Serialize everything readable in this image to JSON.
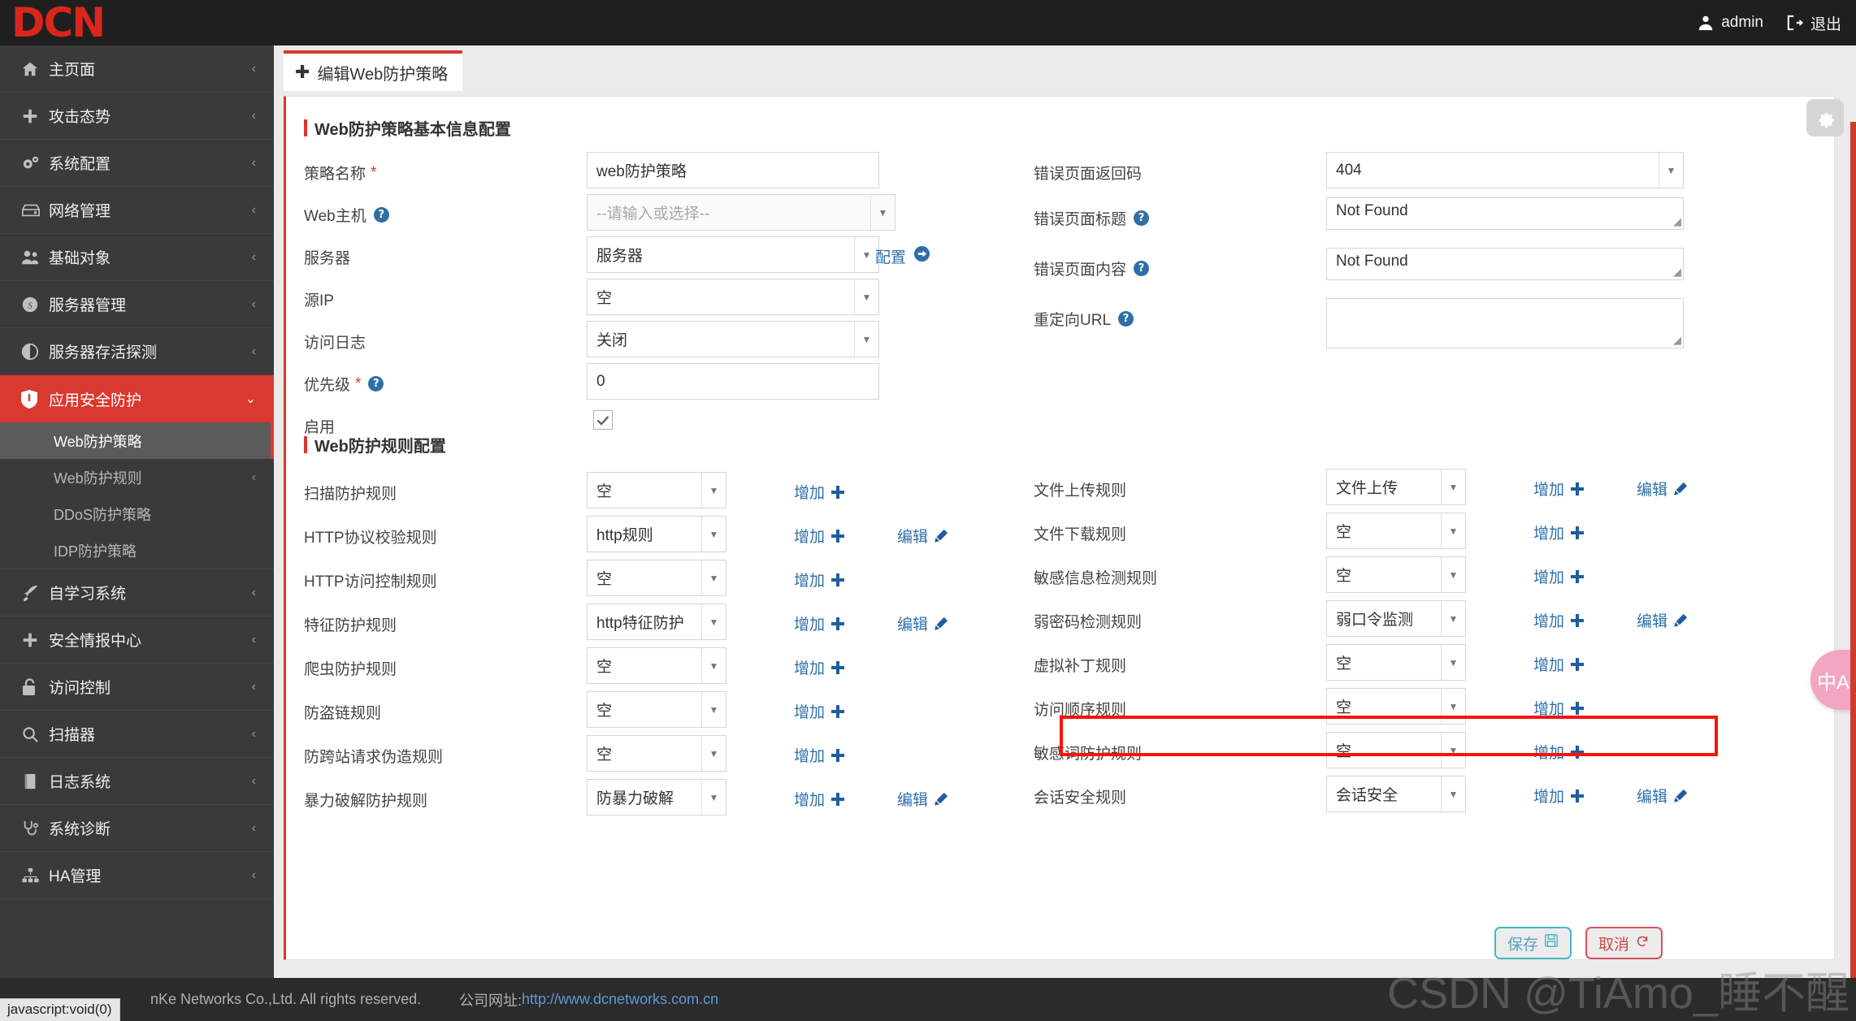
{
  "header": {
    "logo": "DCN",
    "user": "admin",
    "logout": "退出"
  },
  "sidebar": {
    "items": [
      {
        "label": "主页面",
        "icon": "home-icon",
        "arrow": "‹"
      },
      {
        "label": "攻击态势",
        "icon": "plus-icon",
        "arrow": "‹"
      },
      {
        "label": "系统配置",
        "icon": "gears-icon",
        "arrow": "‹"
      },
      {
        "label": "网络管理",
        "icon": "server-icon",
        "arrow": "‹"
      },
      {
        "label": "基础对象",
        "icon": "users-icon",
        "arrow": "‹"
      },
      {
        "label": "服务器管理",
        "icon": "skype-icon",
        "arrow": "‹"
      },
      {
        "label": "服务器存活探测",
        "icon": "contrast-icon",
        "arrow": "‹"
      },
      {
        "label": "应用安全防护",
        "icon": "shield-icon",
        "arrow": "⌄",
        "active": true
      },
      {
        "label": "自学习系统",
        "icon": "rocket-icon",
        "arrow": "‹"
      },
      {
        "label": "安全情报中心",
        "icon": "plus-icon",
        "arrow": "‹"
      },
      {
        "label": "访问控制",
        "icon": "lock-icon",
        "arrow": "‹"
      },
      {
        "label": "扫描器",
        "icon": "search-icon",
        "arrow": "‹"
      },
      {
        "label": "日志系统",
        "icon": "book-icon",
        "arrow": "‹"
      },
      {
        "label": "系统诊断",
        "icon": "stethoscope-icon",
        "arrow": "‹"
      },
      {
        "label": "HA管理",
        "icon": "sitemap-icon",
        "arrow": "‹"
      }
    ],
    "submenu": [
      {
        "label": "Web防护策略",
        "current": true
      },
      {
        "label": "Web防护规则",
        "arrow": "‹"
      },
      {
        "label": "DDoS防护策略"
      },
      {
        "label": "IDP防护策略"
      }
    ]
  },
  "tab": {
    "plus": "✚",
    "label": "编辑Web防护策略"
  },
  "basic": {
    "title": "Web防护策略基本信息配置",
    "left": [
      {
        "label": "策略名称",
        "required": true,
        "type": "text",
        "value": "web防护策略"
      },
      {
        "label": "Web主机",
        "help": true,
        "type": "select",
        "value": "--请输入或选择--",
        "placeholder": true
      },
      {
        "label": "服务器",
        "type": "select",
        "value": "服务器",
        "extra_link": "配置"
      },
      {
        "label": "源IP",
        "type": "select",
        "value": "空"
      },
      {
        "label": "访问日志",
        "type": "select",
        "value": "关闭"
      },
      {
        "label": "优先级",
        "required": true,
        "help": true,
        "type": "text",
        "value": "0"
      },
      {
        "label": "启用",
        "type": "checkbox",
        "checked": true
      }
    ],
    "right": [
      {
        "label": "错误页面返回码",
        "type": "select",
        "value": "404"
      },
      {
        "label": "错误页面标题",
        "help": true,
        "type": "textarea",
        "value": "Not Found"
      },
      {
        "label": "错误页面内容",
        "help": true,
        "type": "textarea",
        "value": "Not Found"
      },
      {
        "label": "重定向URL",
        "help": true,
        "type": "textarea",
        "value": ""
      }
    ]
  },
  "rules": {
    "title": "Web防护规则配置",
    "add_label": "增加",
    "edit_label": "编辑",
    "left": [
      {
        "label": "扫描防护规则",
        "value": "空",
        "add": true,
        "edit": false
      },
      {
        "label": "HTTP协议校验规则",
        "value": "http规则",
        "add": true,
        "edit": true
      },
      {
        "label": "HTTP访问控制规则",
        "value": "空",
        "add": true,
        "edit": false
      },
      {
        "label": "特征防护规则",
        "value": "http特征防护",
        "add": true,
        "edit": true
      },
      {
        "label": "爬虫防护规则",
        "value": "空",
        "add": true,
        "edit": false
      },
      {
        "label": "防盗链规则",
        "value": "空",
        "add": true,
        "edit": false
      },
      {
        "label": "防跨站请求伪造规则",
        "value": "空",
        "add": true,
        "edit": false
      },
      {
        "label": "暴力破解防护规则",
        "value": "防暴力破解",
        "add": true,
        "edit": true
      }
    ],
    "right": [
      {
        "label": "文件上传规则",
        "value": "文件上传",
        "add": true,
        "edit": true
      },
      {
        "label": "文件下载规则",
        "value": "空",
        "add": true,
        "edit": false
      },
      {
        "label": "敏感信息检测规则",
        "value": "空",
        "add": true,
        "edit": false
      },
      {
        "label": "弱密码检测规则",
        "value": "弱口令监测",
        "add": true,
        "edit": true,
        "highlighted": true
      },
      {
        "label": "虚拟补丁规则",
        "value": "空",
        "add": true,
        "edit": false
      },
      {
        "label": "访问顺序规则",
        "value": "空",
        "add": true,
        "edit": false
      },
      {
        "label": "敏感词防护规则",
        "value": "空",
        "add": true,
        "edit": false
      },
      {
        "label": "会话安全规则",
        "value": "会话安全",
        "add": true,
        "edit": true
      }
    ]
  },
  "actions": {
    "save": "保存",
    "cancel": "取消"
  },
  "footer": {
    "copyright": "nKe Networks Co.,Ltd. All rights reserved.",
    "site_label": "公司网址:",
    "site_url": "http://www.dcnetworks.com.cn",
    "status_tip": "javascript:void(0)"
  },
  "watermark": "CSDN @TiAmo_睡不醒",
  "colors": {
    "brand_red": "#d9392e",
    "accent_blue": "#2f6fa8",
    "highlight_red": "#f5150b"
  }
}
